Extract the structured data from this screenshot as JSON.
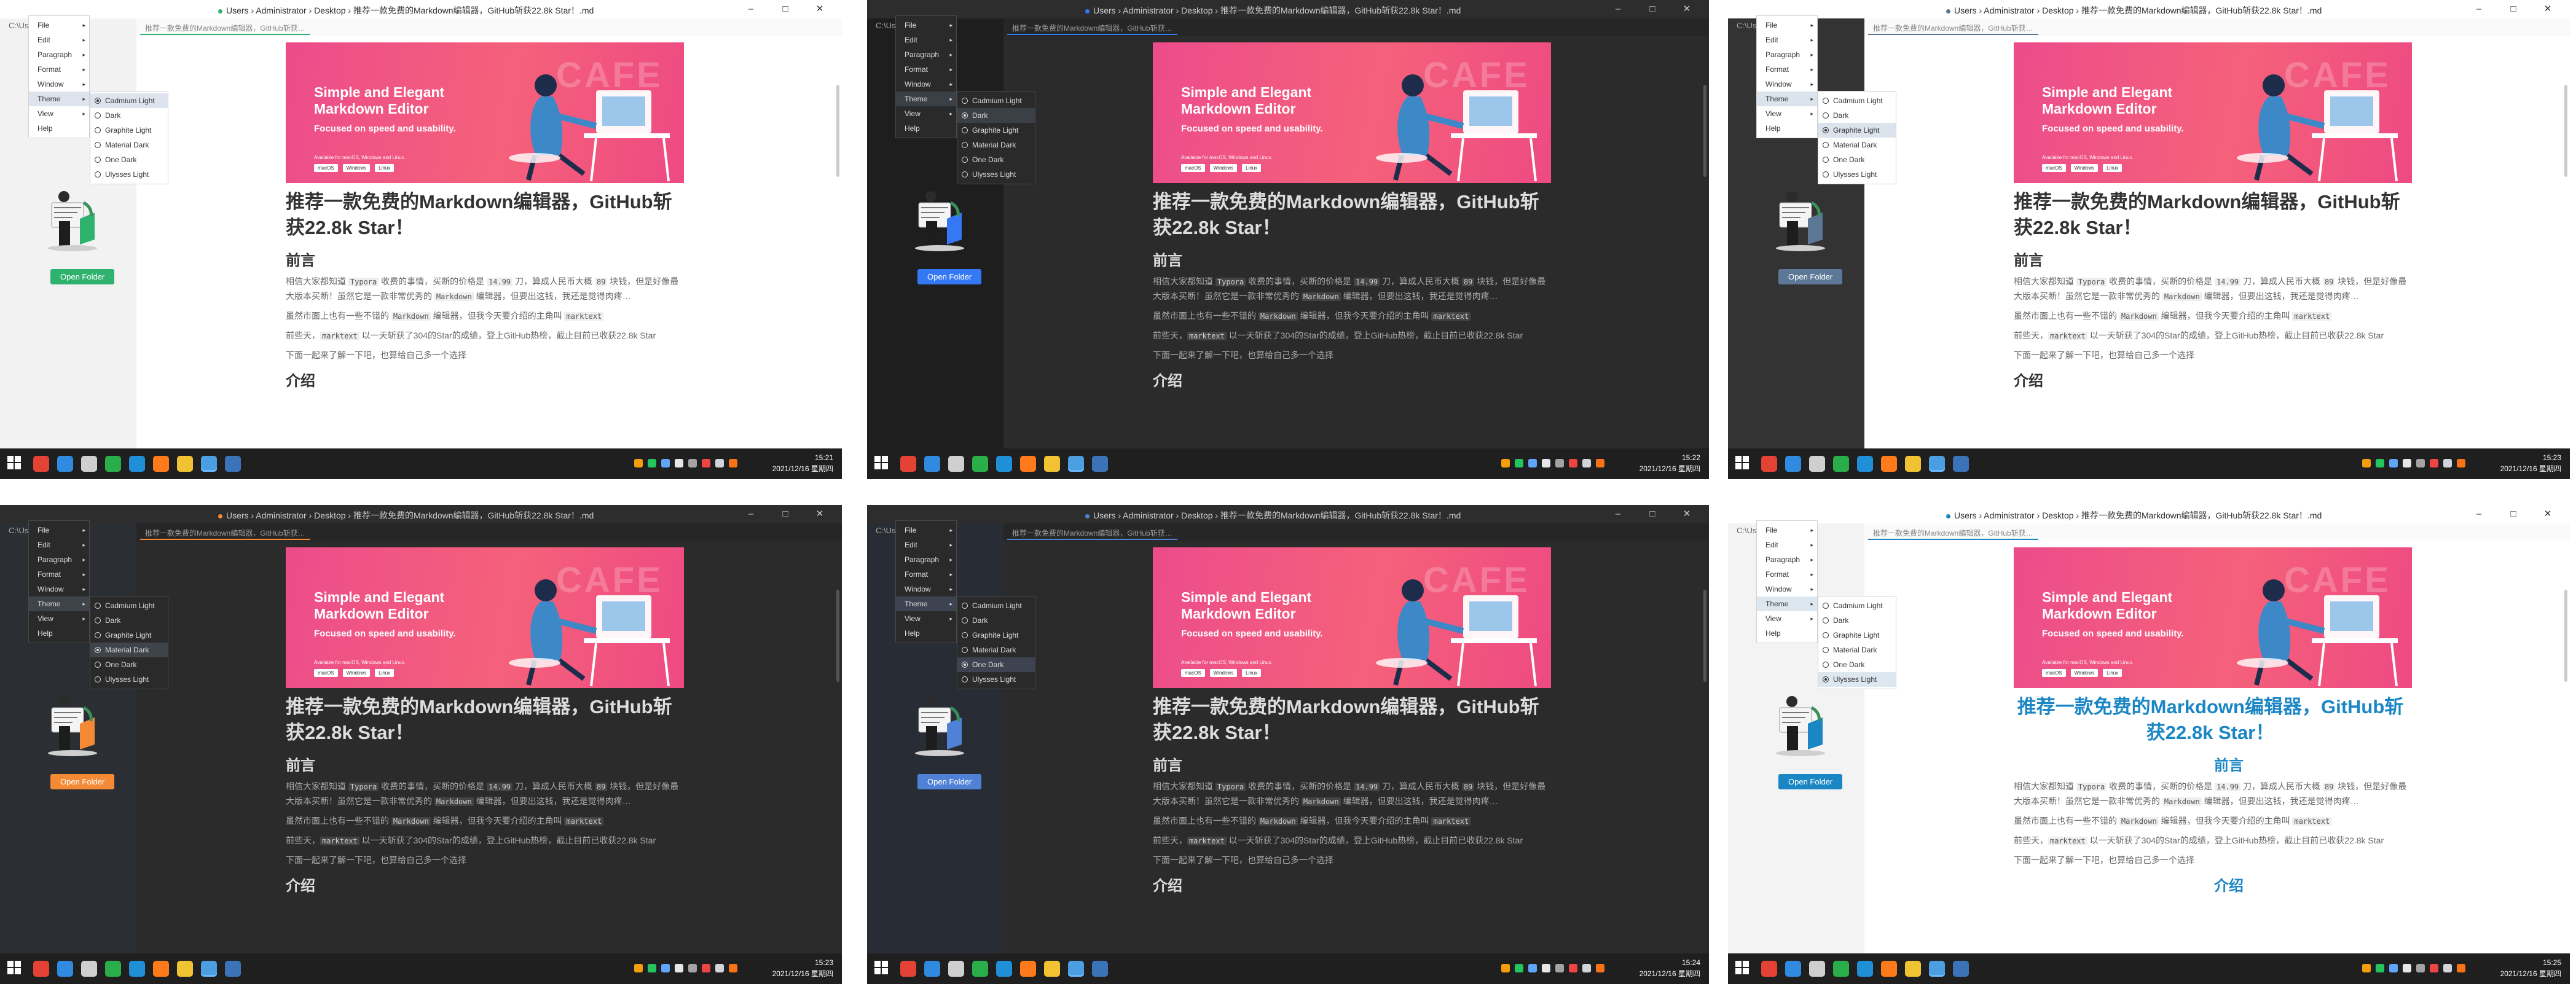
{
  "breadcrumb": [
    "Users",
    "Administrator",
    "Desktop",
    "推荐一款免费的Markdown编辑器，GitHub斩获22.8k Star！.md"
  ],
  "window_controls": [
    "–",
    "□",
    "✕"
  ],
  "sidebar_top": "C:\\Us",
  "tab_label": "推荐一款免费的Markdown编辑器，GitHub斩获…",
  "open_folder": "Open Folder",
  "menu": [
    "File",
    "Edit",
    "Paragraph",
    "Format",
    "Window",
    "Theme",
    "View",
    "Help"
  ],
  "themes": [
    "Cadmium Light",
    "Dark",
    "Graphite Light",
    "Material Dark",
    "One Dark",
    "Ulysses Light"
  ],
  "banner": {
    "title": "Simple and Elegant Markdown Editor",
    "subtitle": "Focused on speed and usability.",
    "available": "Available for macOS, Windows and Linux.",
    "os": [
      "macOS",
      "Windows",
      "Linux"
    ],
    "cafe": "CAFE"
  },
  "article": {
    "title": "推荐一款免费的Markdown编辑器，GitHub斩获22.8k Star！",
    "heading1": "前言",
    "p1a": "相信大家都知道 ",
    "p1b": "Typora",
    "p1c": " 收费的事情，买断的价格是 ",
    "p1d": "14.99",
    "p1e": " 刀，算成人民币大概 ",
    "p1f": "89",
    "p1g": " 块钱，但是好像最大版本买断！虽然它是一款非常优秀的 ",
    "p1h": "Markdown",
    "p1i": " 编辑器，但要出这钱，我还是觉得肉疼…",
    "p2a": "虽然市面上也有一些不错的 ",
    "p2b": "Markdown",
    "p2c": " 编辑器，但我今天要介绍的主角叫 ",
    "p2d": "marktext",
    "p3a": "前些天，",
    "p3b": "marktext",
    "p3c": " 以一天斩获了304的Star的成绩，登上GitHub热榜，截止目前已收获22.8k Star",
    "p4": "下面一起来了解一下吧，也算给自己多一个选择",
    "heading2": "介绍"
  },
  "screens": [
    {
      "theme": "Cadmium Light",
      "mode": "light",
      "selected": 0,
      "time": "15:21",
      "date": "2021/12/16 星期四",
      "accent": "#2fb26e",
      "title_color": "#333333",
      "sidebar_bg": "#f2f2f2",
      "menu_bg": "#ffffff",
      "menu_hl": "#dde4ee"
    },
    {
      "theme": "Dark",
      "mode": "dark",
      "selected": 1,
      "time": "15:22",
      "date": "2021/12/16 星期四",
      "accent": "#3478f6",
      "title_color": "#dddddd",
      "sidebar_bg": "#1e1e1e",
      "menu_bg": "#2a2a2a",
      "menu_hl": "#3b3f46"
    },
    {
      "theme": "Graphite Light",
      "mode": "light",
      "selected": 2,
      "time": "15:23",
      "date": "2021/12/16 星期四",
      "accent": "#5c7896",
      "title_color": "#333333",
      "sidebar_bg": "#333333",
      "menu_bg": "#ffffff",
      "menu_hl": "#dbe3ec"
    },
    {
      "theme": "Material Dark",
      "mode": "dark",
      "selected": 3,
      "time": "15:23",
      "date": "2021/12/16 星期四",
      "accent": "#f58a36",
      "title_color": "#dddddd",
      "sidebar_bg": "#2b2e33",
      "menu_bg": "#2a2a2a",
      "menu_hl": "#3f434a"
    },
    {
      "theme": "One Dark",
      "mode": "dark",
      "selected": 4,
      "time": "15:24",
      "date": "2021/12/16 星期四",
      "accent": "#4f82d6",
      "title_color": "#dddddd",
      "sidebar_bg": "#282c34",
      "menu_bg": "#2a2a2a",
      "menu_hl": "#3d4350"
    },
    {
      "theme": "Ulysses Light",
      "mode": "light",
      "selected": 5,
      "time": "15:25",
      "date": "2021/12/16 星期四",
      "accent": "#1b86c4",
      "title_color": "#1b86c4",
      "sidebar_bg": "#f3f3f3",
      "menu_bg": "#ffffff",
      "menu_hl": "#dde7f0"
    }
  ],
  "taskbar_apps": [
    "Chrome",
    "VS Code",
    "Terminal",
    "WeChat",
    "Edge",
    "Firefox",
    "Explorer",
    "MarkText",
    "Python"
  ]
}
